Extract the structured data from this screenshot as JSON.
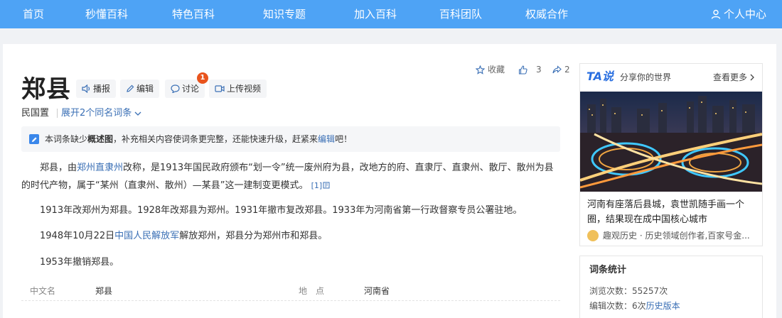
{
  "nav": {
    "items": [
      "首页",
      "秒懂百科",
      "特色百科",
      "知识专题",
      "加入百科",
      "百科团队",
      "权威合作"
    ],
    "user_center": "个人中心"
  },
  "entry": {
    "title": "郑县",
    "buttons": {
      "play": "播报",
      "edit": "编辑",
      "discuss": "讨论",
      "discuss_badge": "1",
      "upload_video": "上传视频"
    },
    "actions": {
      "collect": "收藏",
      "like_count": "3",
      "share_count": "2"
    },
    "subtitle": "民国置",
    "expand": "展开2个同名词条"
  },
  "notice": {
    "pre": "本词条缺少",
    "bold": "概述图",
    "mid": "，补充相关内容使词条更完整，还能快速升级，赶紧来",
    "link": "编辑",
    "post": "吧！"
  },
  "paragraphs": {
    "p1": {
      "a": "郑县，由",
      "link": "郑州直隶州",
      "b": "改称，是1913年国民政府颁布“划一令”统一废州府为县，改地方的府、直隶厅、直隶州、散厅、散州为县的时代产物，属于“某州（直隶州、散州）—某县”这一建制变更模式。",
      "cite": "[1]"
    },
    "p2": "1913年改郑州为郑县。1928年改郑县为郑州。1931年撤市复改郑县。1933年为河南省第一行政督察专员公署驻地。",
    "p3": {
      "a": "1948年10月22日",
      "link": "中国人民解放军",
      "b": "解放郑州，郑县分为郑州市和郑县。"
    },
    "p4": "1953年撤销郑县。"
  },
  "basic_info": {
    "k1": "中文名",
    "v1": "郑县",
    "k2": "地　点",
    "v2": "河南省"
  },
  "ta": {
    "logo": "TA说",
    "slogan": "分享你的世界",
    "more": "查看更多",
    "headline": "河南有座落后县城，袁世凯随手画一个圈，结果现在成中国核心城市",
    "author": "趣观历史 · 历史领域创作者,百家号金..."
  },
  "stats": {
    "title": "词条统计",
    "views_label": "浏览次数：",
    "views": "55257次",
    "edits_label": "编辑次数：",
    "edits": "6次",
    "history_link": "历史版本"
  },
  "colors": {
    "nav_bg": "#4ea3f5",
    "link": "#3a6fb5",
    "badge": "#e9541d"
  }
}
